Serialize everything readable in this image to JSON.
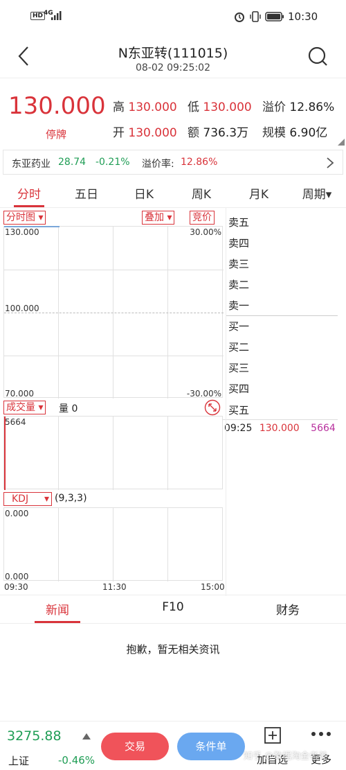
{
  "status_bar": {
    "network_badge": "HD",
    "network_type": "4G",
    "time": "10:30"
  },
  "header": {
    "title": "N东亚转(111015)",
    "timestamp": "08-02 09:25:02"
  },
  "quote": {
    "price": "130.000",
    "status": "停牌",
    "high_label": "高",
    "high_value": "130.000",
    "low_label": "低",
    "low_value": "130.000",
    "premium_label": "溢价",
    "premium_value": "12.86%",
    "open_label": "开",
    "open_value": "130.000",
    "amount_label": "额",
    "amount_value": "736.3万",
    "scale_label": "规模",
    "scale_value": "6.90亿"
  },
  "underlying": {
    "name": "东亚药业",
    "price": "28.74",
    "change": "-0.21%",
    "premium_label": "溢价率:",
    "premium_value": "12.86%"
  },
  "period_tabs": [
    {
      "label": "分时",
      "active": true
    },
    {
      "label": "五日",
      "active": false
    },
    {
      "label": "日K",
      "active": false
    },
    {
      "label": "周K",
      "active": false
    },
    {
      "label": "月K",
      "active": false
    },
    {
      "label": "周期▾",
      "active": false
    }
  ],
  "chart_controls": {
    "chart_type": "分时图",
    "overlay": "叠加",
    "auction": "竞价"
  },
  "price_chart": {
    "y_top": "130.000",
    "y_mid": "100.000",
    "y_bottom": "70.000",
    "pct_top": "30.00%",
    "pct_bottom": "-30.00%"
  },
  "order_book": {
    "asks": [
      "卖五",
      "卖四",
      "卖三",
      "卖二",
      "卖一"
    ],
    "bids": [
      "买一",
      "买二",
      "买三",
      "买四",
      "买五"
    ],
    "trade": {
      "time": "09:25",
      "price": "130.000",
      "volume": "5664"
    }
  },
  "volume_panel": {
    "selector": "成交量",
    "label": "量 0",
    "max": "5664"
  },
  "kdj_panel": {
    "selector": "KDJ",
    "params": "(9,3,3)",
    "y_top": "0.000",
    "y_bottom": "0.000",
    "x_labels": [
      "09:30",
      "11:30",
      "15:00"
    ]
  },
  "info_tabs": [
    {
      "label": "新闻",
      "active": true
    },
    {
      "label": "F10",
      "active": false
    },
    {
      "label": "财务",
      "active": false
    }
  ],
  "news_empty": "抱歉，暂无相关资讯",
  "bottom_bar": {
    "index_value": "3275.88",
    "index_name": "上证",
    "index_change": "-0.46%",
    "trade_btn": "交易",
    "condition_btn": "条件单",
    "watchlist_label": "加自选",
    "more_label": "更多",
    "watermark": "知乎 @数据淘金者美"
  },
  "colors": {
    "red": "#d9333a",
    "green": "#1f9d55",
    "trade_btn": "#f0535a",
    "condition_btn": "#6aa8f0"
  }
}
